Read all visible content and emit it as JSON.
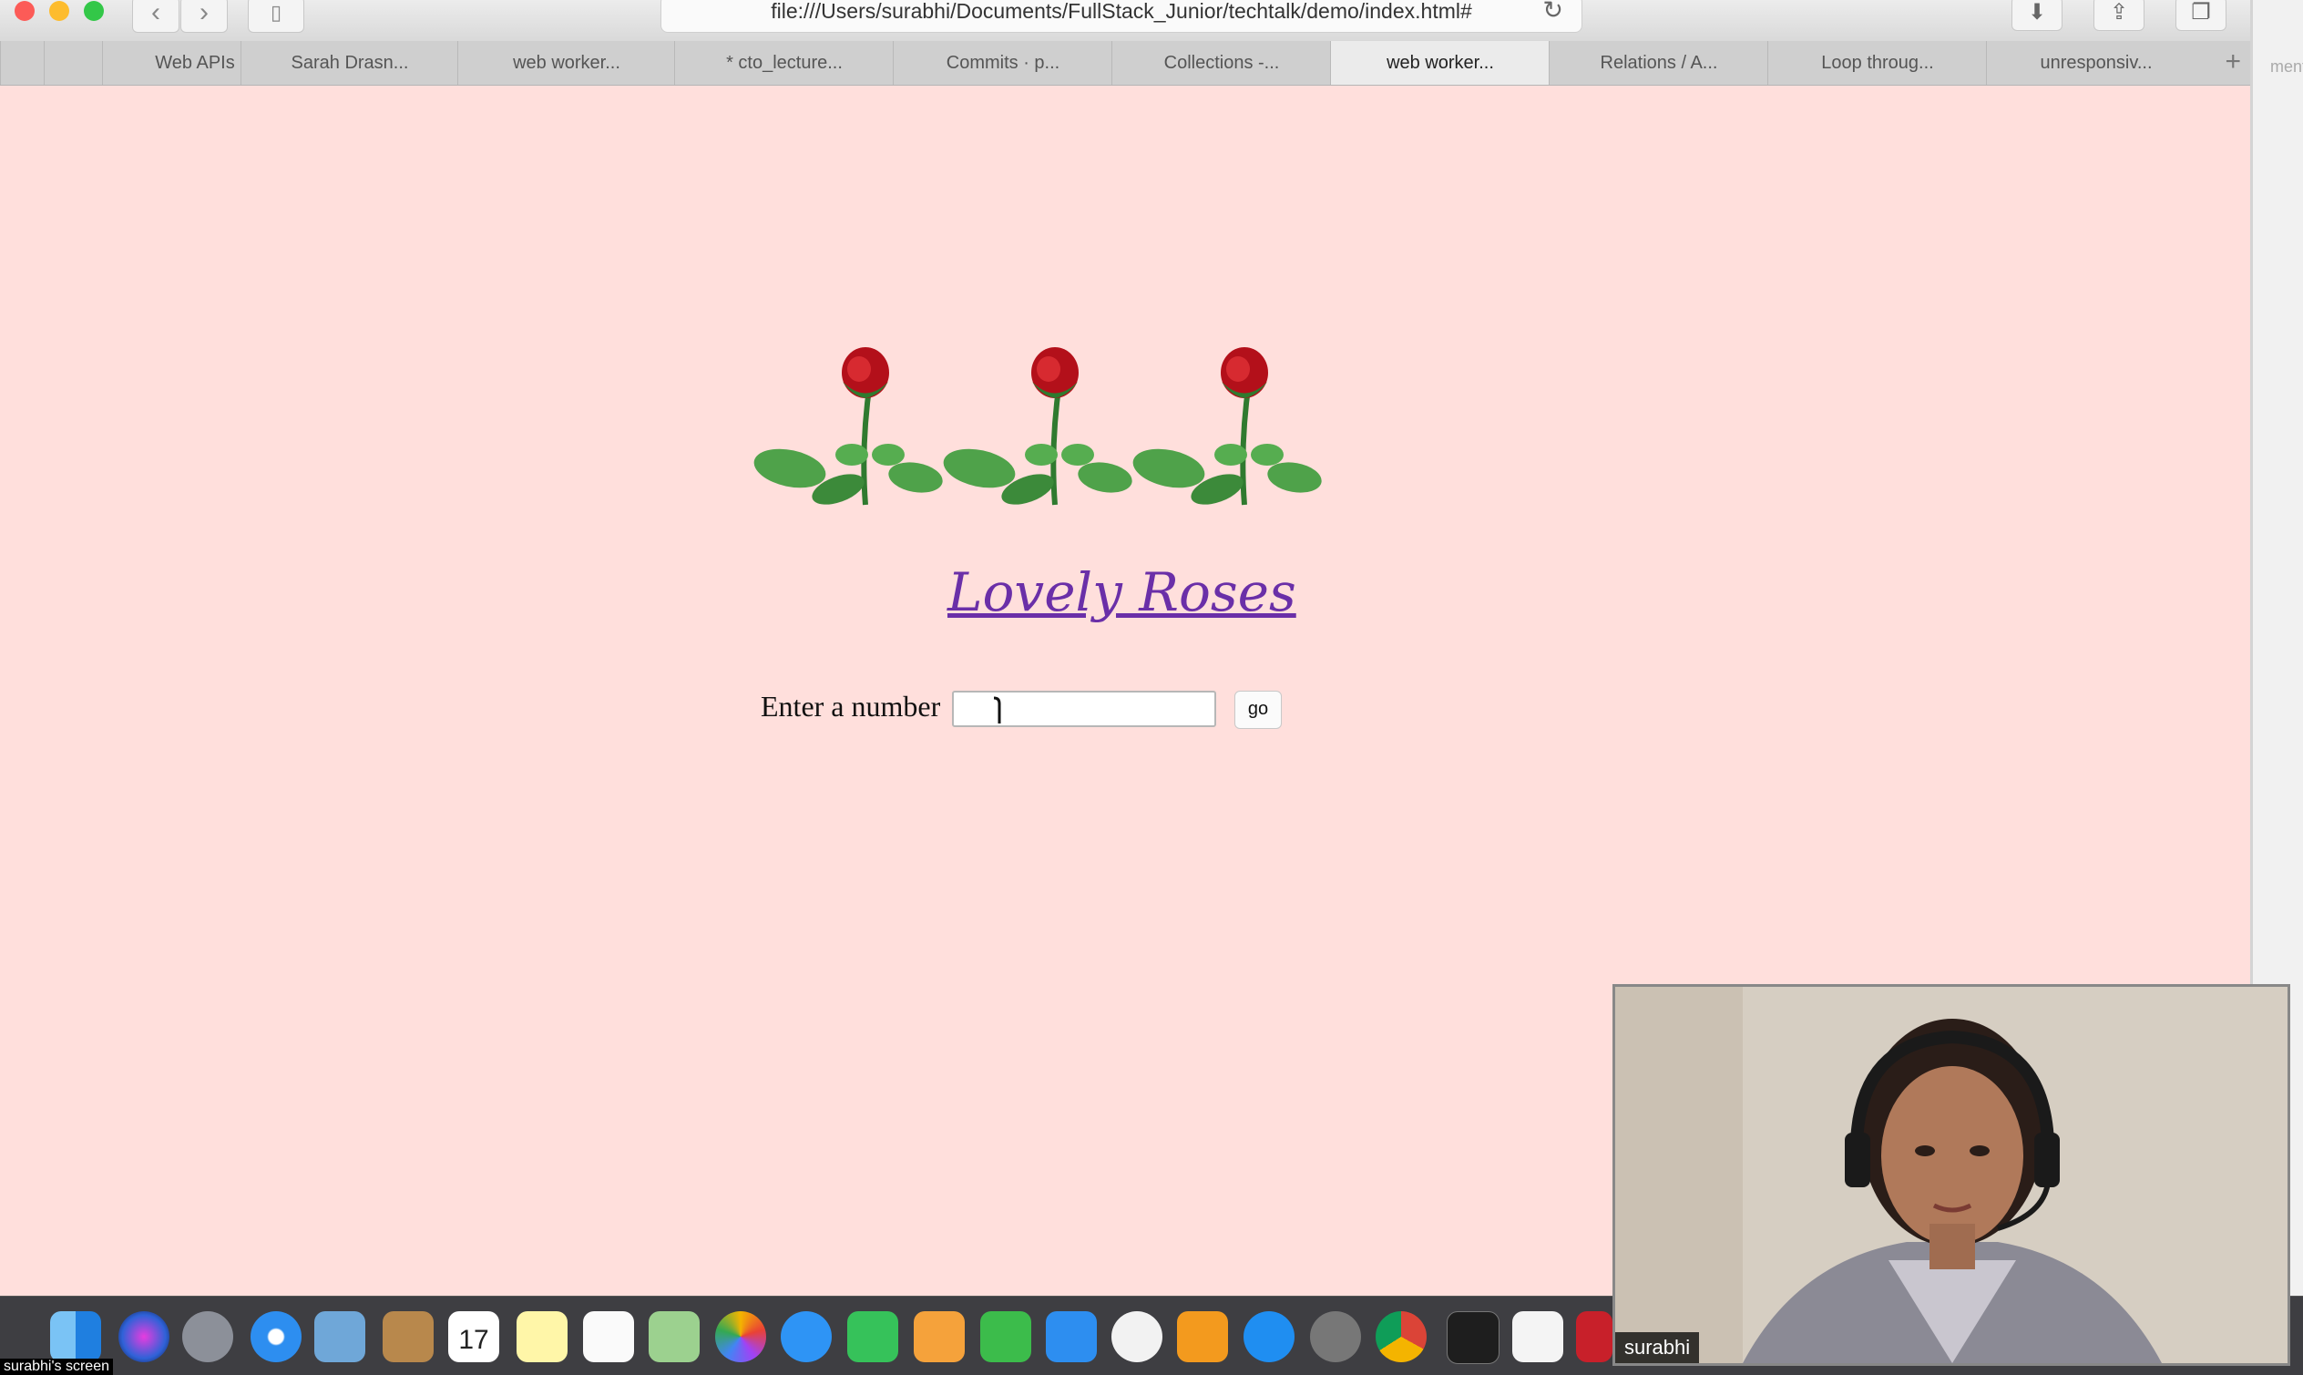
{
  "browser": {
    "url": "file:///Users/surabhi/Documents/FullStack_Junior/techtalk/demo/index.html#",
    "tabs": [
      {
        "label": "Web APIs",
        "active": false
      },
      {
        "label": "Sarah Drasn...",
        "active": false
      },
      {
        "label": "web worker...",
        "active": false
      },
      {
        "label": "* cto_lecture...",
        "active": false
      },
      {
        "label": "Commits · p...",
        "active": false
      },
      {
        "label": "Collections -...",
        "active": false
      },
      {
        "label": "web worker...",
        "active": true
      },
      {
        "label": "Relations / A...",
        "active": false
      },
      {
        "label": "Loop throug...",
        "active": false
      },
      {
        "label": "unresponsiv...",
        "active": false
      }
    ],
    "side_panel_text": "ment"
  },
  "page": {
    "heading": "Lovely Roses",
    "prompt_label": "Enter a number",
    "input_value": "",
    "go_label": "go",
    "background": "#ffdfdc"
  },
  "video": {
    "participant_name": "surabhi"
  },
  "dock": {
    "screen_label": "surabhi's screen",
    "apps": [
      "finder-icon",
      "siri-icon",
      "launchpad-icon",
      "safari-icon",
      "mail-icon",
      "contacts-icon",
      "calendar-icon",
      "notes-icon",
      "reminders-icon",
      "maps-icon",
      "photos-icon",
      "messages-icon",
      "facetime-icon",
      "pages-icon",
      "numbers-icon",
      "keynote-icon",
      "itunes-icon",
      "ibooks-icon",
      "app-store-icon",
      "system-preferences-icon",
      "chrome-icon",
      "terminal-icon",
      "textedit-icon",
      "acrobat-icon"
    ],
    "calendar_day": "17"
  }
}
